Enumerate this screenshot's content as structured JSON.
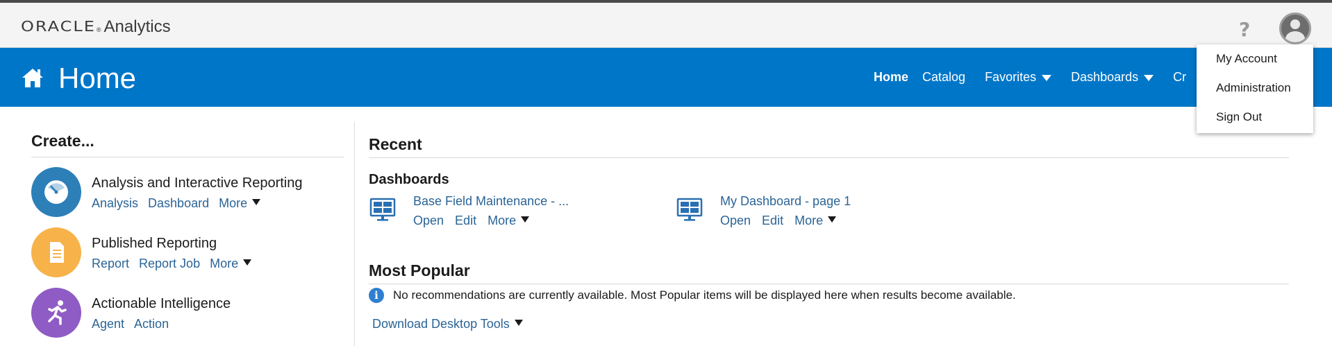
{
  "brand": {
    "oracle": "ORACLE",
    "reg": "®",
    "product": "Analytics"
  },
  "topbar": {
    "help_glyph": "?"
  },
  "user_menu": {
    "items": [
      "My Account",
      "Administration",
      "Sign Out"
    ]
  },
  "header": {
    "title": "Home",
    "nav": [
      {
        "label": "Home",
        "active": true,
        "dropdown": false
      },
      {
        "label": "Catalog",
        "active": false,
        "dropdown": false
      },
      {
        "label": "Favorites",
        "active": false,
        "dropdown": true
      },
      {
        "label": "Dashboards",
        "active": false,
        "dropdown": true
      },
      {
        "label": "Cr",
        "active": false,
        "dropdown": false
      }
    ]
  },
  "create": {
    "heading": "Create...",
    "items": [
      {
        "title": "Analysis and Interactive Reporting",
        "links": [
          "Analysis",
          "Dashboard",
          "More"
        ],
        "color": "#2d7fb8",
        "icon": "gauge-icon"
      },
      {
        "title": "Published Reporting",
        "links": [
          "Report",
          "Report Job",
          "More"
        ],
        "color": "#f7b24a",
        "icon": "document-icon"
      },
      {
        "title": "Actionable Intelligence",
        "links": [
          "Agent",
          "Action"
        ],
        "color": "#8e5cc4",
        "icon": "runner-icon"
      }
    ]
  },
  "recent": {
    "heading": "Recent",
    "subheading": "Dashboards",
    "items": [
      {
        "name": "Base Field Maintenance - ...",
        "links": [
          "Open",
          "Edit",
          "More"
        ]
      },
      {
        "name": "My Dashboard - page 1",
        "links": [
          "Open",
          "Edit",
          "More"
        ]
      }
    ]
  },
  "popular": {
    "heading": "Most Popular",
    "message": "No recommendations are currently available. Most Popular items will be displayed here when results become available.",
    "info_glyph": "i"
  },
  "download": {
    "label": "Download Desktop Tools"
  }
}
